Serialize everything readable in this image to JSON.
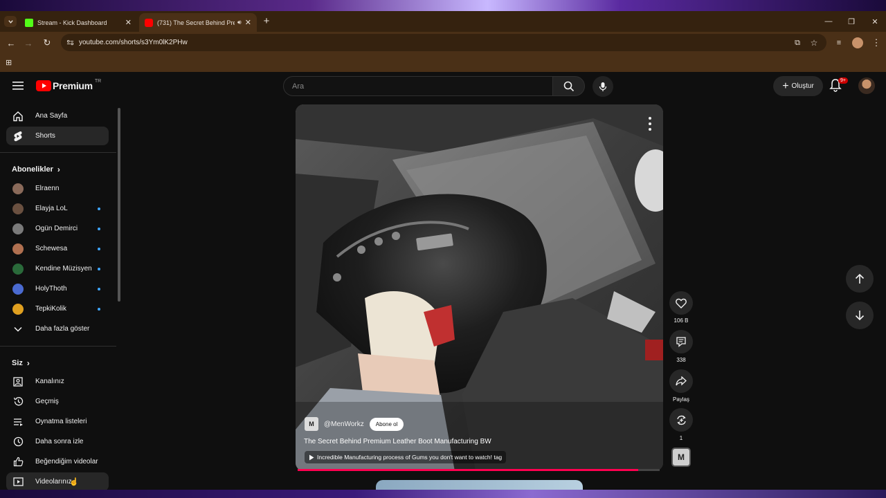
{
  "browser": {
    "tabs": [
      {
        "title": "Stream - Kick Dashboard",
        "favicon_color": "#53fc18",
        "active": false
      },
      {
        "title": "(731) The Secret Behind Pre",
        "favicon_color": "#ff0000",
        "active": true
      }
    ],
    "url": "youtube.com/shorts/s3Ym0lK2PHw"
  },
  "header": {
    "logo_text": "Premium",
    "logo_region": "TR",
    "search_placeholder": "Ara",
    "create_label": "Oluştur",
    "notif_count": "9+"
  },
  "sidebar": {
    "main": [
      {
        "label": "Ana Sayfa",
        "icon": "home-icon"
      },
      {
        "label": "Shorts",
        "icon": "shorts-icon",
        "active": true
      }
    ],
    "subscriptions_title": "Abonelikler",
    "subscriptions": [
      {
        "label": "Elraenn",
        "color": "#8a6a5a",
        "new": false
      },
      {
        "label": "Elayja LoL",
        "color": "#6a5040",
        "new": true
      },
      {
        "label": "Ogün Demirci",
        "color": "#7a7a7a",
        "new": true
      },
      {
        "label": "Schewesa",
        "color": "#b07050",
        "new": true
      },
      {
        "label": "Kendine Müzisyen",
        "color": "#2a6a3a",
        "new": true
      },
      {
        "label": "HolyThoth",
        "color": "#4a6ad0",
        "new": true
      },
      {
        "label": "TepkiKolik",
        "color": "#e0a020",
        "new": true
      }
    ],
    "show_more": "Daha fazla göster",
    "you_title": "Siz",
    "you": [
      {
        "label": "Kanalınız",
        "icon": "channel-icon"
      },
      {
        "label": "Geçmiş",
        "icon": "history-icon"
      },
      {
        "label": "Oynatma listeleri",
        "icon": "playlist-icon"
      },
      {
        "label": "Daha sonra izle",
        "icon": "watch-later-icon"
      },
      {
        "label": "Beğendiğim videolar",
        "icon": "like-icon"
      },
      {
        "label": "Videolarınız",
        "icon": "your-videos-icon"
      }
    ]
  },
  "short": {
    "channel": "@MenWorkz",
    "channel_badge": "M",
    "subscribe_label": "Abone ol",
    "title": "The Secret Behind Premium Leather Boot Manufacturing BW",
    "suggestion": "Incredible Manufacturing process of Gums you don't want to watch! tag",
    "progress": 0.94
  },
  "actions": {
    "likes": "106 B",
    "comments": "338",
    "share": "Paylaş",
    "remix": "1"
  }
}
